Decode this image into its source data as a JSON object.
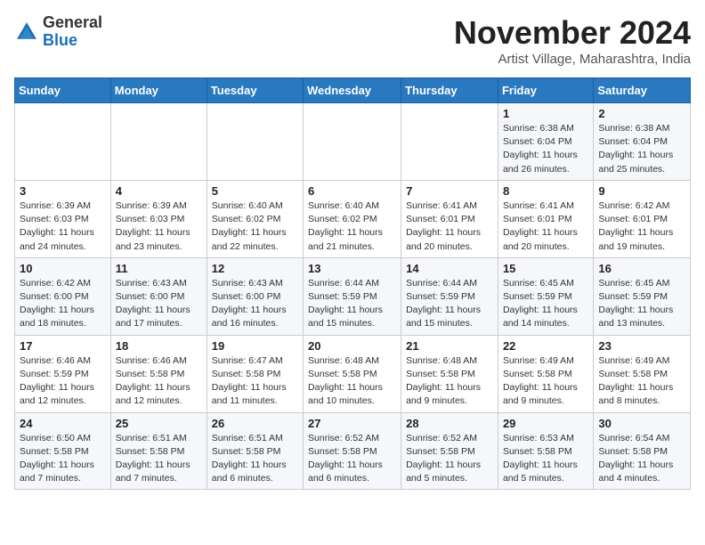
{
  "header": {
    "logo_general": "General",
    "logo_blue": "Blue",
    "month_title": "November 2024",
    "subtitle": "Artist Village, Maharashtra, India"
  },
  "weekdays": [
    "Sunday",
    "Monday",
    "Tuesday",
    "Wednesday",
    "Thursday",
    "Friday",
    "Saturday"
  ],
  "weeks": [
    [
      {
        "day": "",
        "info": ""
      },
      {
        "day": "",
        "info": ""
      },
      {
        "day": "",
        "info": ""
      },
      {
        "day": "",
        "info": ""
      },
      {
        "day": "",
        "info": ""
      },
      {
        "day": "1",
        "info": "Sunrise: 6:38 AM\nSunset: 6:04 PM\nDaylight: 11 hours and 26 minutes."
      },
      {
        "day": "2",
        "info": "Sunrise: 6:38 AM\nSunset: 6:04 PM\nDaylight: 11 hours and 25 minutes."
      }
    ],
    [
      {
        "day": "3",
        "info": "Sunrise: 6:39 AM\nSunset: 6:03 PM\nDaylight: 11 hours and 24 minutes."
      },
      {
        "day": "4",
        "info": "Sunrise: 6:39 AM\nSunset: 6:03 PM\nDaylight: 11 hours and 23 minutes."
      },
      {
        "day": "5",
        "info": "Sunrise: 6:40 AM\nSunset: 6:02 PM\nDaylight: 11 hours and 22 minutes."
      },
      {
        "day": "6",
        "info": "Sunrise: 6:40 AM\nSunset: 6:02 PM\nDaylight: 11 hours and 21 minutes."
      },
      {
        "day": "7",
        "info": "Sunrise: 6:41 AM\nSunset: 6:01 PM\nDaylight: 11 hours and 20 minutes."
      },
      {
        "day": "8",
        "info": "Sunrise: 6:41 AM\nSunset: 6:01 PM\nDaylight: 11 hours and 20 minutes."
      },
      {
        "day": "9",
        "info": "Sunrise: 6:42 AM\nSunset: 6:01 PM\nDaylight: 11 hours and 19 minutes."
      }
    ],
    [
      {
        "day": "10",
        "info": "Sunrise: 6:42 AM\nSunset: 6:00 PM\nDaylight: 11 hours and 18 minutes."
      },
      {
        "day": "11",
        "info": "Sunrise: 6:43 AM\nSunset: 6:00 PM\nDaylight: 11 hours and 17 minutes."
      },
      {
        "day": "12",
        "info": "Sunrise: 6:43 AM\nSunset: 6:00 PM\nDaylight: 11 hours and 16 minutes."
      },
      {
        "day": "13",
        "info": "Sunrise: 6:44 AM\nSunset: 5:59 PM\nDaylight: 11 hours and 15 minutes."
      },
      {
        "day": "14",
        "info": "Sunrise: 6:44 AM\nSunset: 5:59 PM\nDaylight: 11 hours and 15 minutes."
      },
      {
        "day": "15",
        "info": "Sunrise: 6:45 AM\nSunset: 5:59 PM\nDaylight: 11 hours and 14 minutes."
      },
      {
        "day": "16",
        "info": "Sunrise: 6:45 AM\nSunset: 5:59 PM\nDaylight: 11 hours and 13 minutes."
      }
    ],
    [
      {
        "day": "17",
        "info": "Sunrise: 6:46 AM\nSunset: 5:59 PM\nDaylight: 11 hours and 12 minutes."
      },
      {
        "day": "18",
        "info": "Sunrise: 6:46 AM\nSunset: 5:58 PM\nDaylight: 11 hours and 12 minutes."
      },
      {
        "day": "19",
        "info": "Sunrise: 6:47 AM\nSunset: 5:58 PM\nDaylight: 11 hours and 11 minutes."
      },
      {
        "day": "20",
        "info": "Sunrise: 6:48 AM\nSunset: 5:58 PM\nDaylight: 11 hours and 10 minutes."
      },
      {
        "day": "21",
        "info": "Sunrise: 6:48 AM\nSunset: 5:58 PM\nDaylight: 11 hours and 9 minutes."
      },
      {
        "day": "22",
        "info": "Sunrise: 6:49 AM\nSunset: 5:58 PM\nDaylight: 11 hours and 9 minutes."
      },
      {
        "day": "23",
        "info": "Sunrise: 6:49 AM\nSunset: 5:58 PM\nDaylight: 11 hours and 8 minutes."
      }
    ],
    [
      {
        "day": "24",
        "info": "Sunrise: 6:50 AM\nSunset: 5:58 PM\nDaylight: 11 hours and 7 minutes."
      },
      {
        "day": "25",
        "info": "Sunrise: 6:51 AM\nSunset: 5:58 PM\nDaylight: 11 hours and 7 minutes."
      },
      {
        "day": "26",
        "info": "Sunrise: 6:51 AM\nSunset: 5:58 PM\nDaylight: 11 hours and 6 minutes."
      },
      {
        "day": "27",
        "info": "Sunrise: 6:52 AM\nSunset: 5:58 PM\nDaylight: 11 hours and 6 minutes."
      },
      {
        "day": "28",
        "info": "Sunrise: 6:52 AM\nSunset: 5:58 PM\nDaylight: 11 hours and 5 minutes."
      },
      {
        "day": "29",
        "info": "Sunrise: 6:53 AM\nSunset: 5:58 PM\nDaylight: 11 hours and 5 minutes."
      },
      {
        "day": "30",
        "info": "Sunrise: 6:54 AM\nSunset: 5:58 PM\nDaylight: 11 hours and 4 minutes."
      }
    ]
  ]
}
